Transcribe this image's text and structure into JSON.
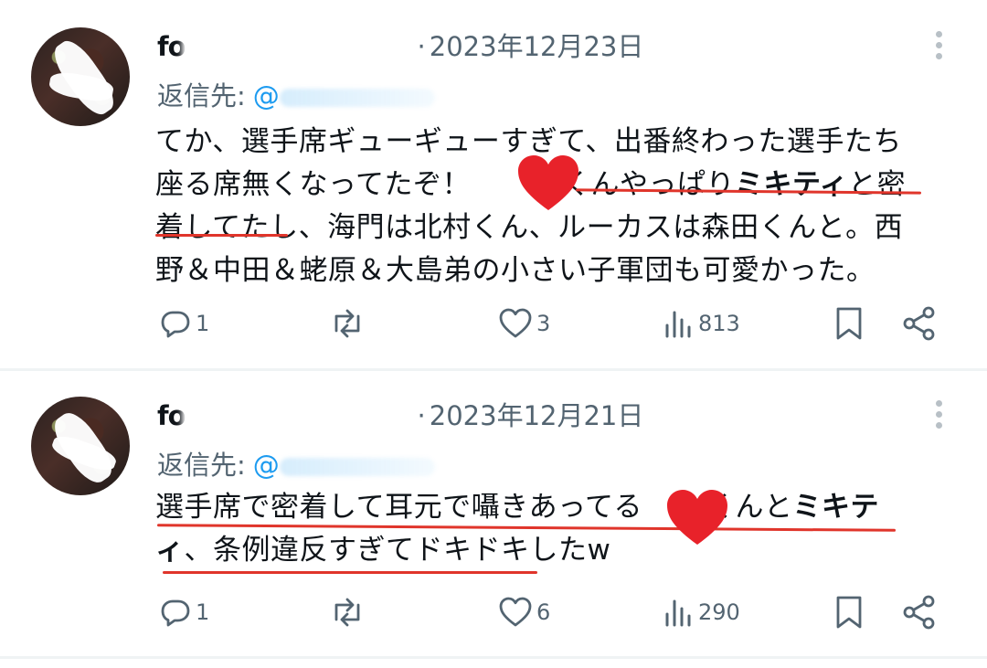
{
  "posts": [
    {
      "handle": "fo",
      "sep": "·",
      "date": "2023年12月23日",
      "reply_label": "返信先:",
      "reply_at": "@",
      "text_parts": [
        "てか、選手席ギューギューすぎて、出番終わった選手たち",
        "座る席無くなってたぞ！",
        "くんやっぱり",
        "ミキティ",
        "と密",
        "着してたし、海門は北村くん、ルーカスは森田くんと。西",
        "野＆中田＆蛯原＆大島弟の小さい子軍団も可愛かった。"
      ],
      "stats": {
        "replies": "1",
        "reposts": "",
        "likes": "3",
        "views": "813"
      }
    },
    {
      "handle": "fo",
      "sep": "·",
      "date": "2023年12月21日",
      "reply_label": "返信先:",
      "reply_at": "@",
      "text_parts": [
        "選手席で密着して耳元で囁きあってる",
        "くんと",
        "ミキテ",
        "ィ",
        "、条例違反すぎてドキドキしたw"
      ],
      "stats": {
        "replies": "1",
        "reposts": "",
        "likes": "6",
        "views": "290"
      }
    }
  ],
  "icons": [
    "more-icon",
    "reply-icon",
    "repost-icon",
    "like-icon",
    "views-icon",
    "bookmark-icon",
    "share-icon",
    "heart-sticker-icon"
  ],
  "colors": {
    "text": "#0f1419",
    "secondary": "#536471",
    "accent": "#1d9bf0",
    "underline": "#e0352b",
    "heart": "#e8222a"
  }
}
